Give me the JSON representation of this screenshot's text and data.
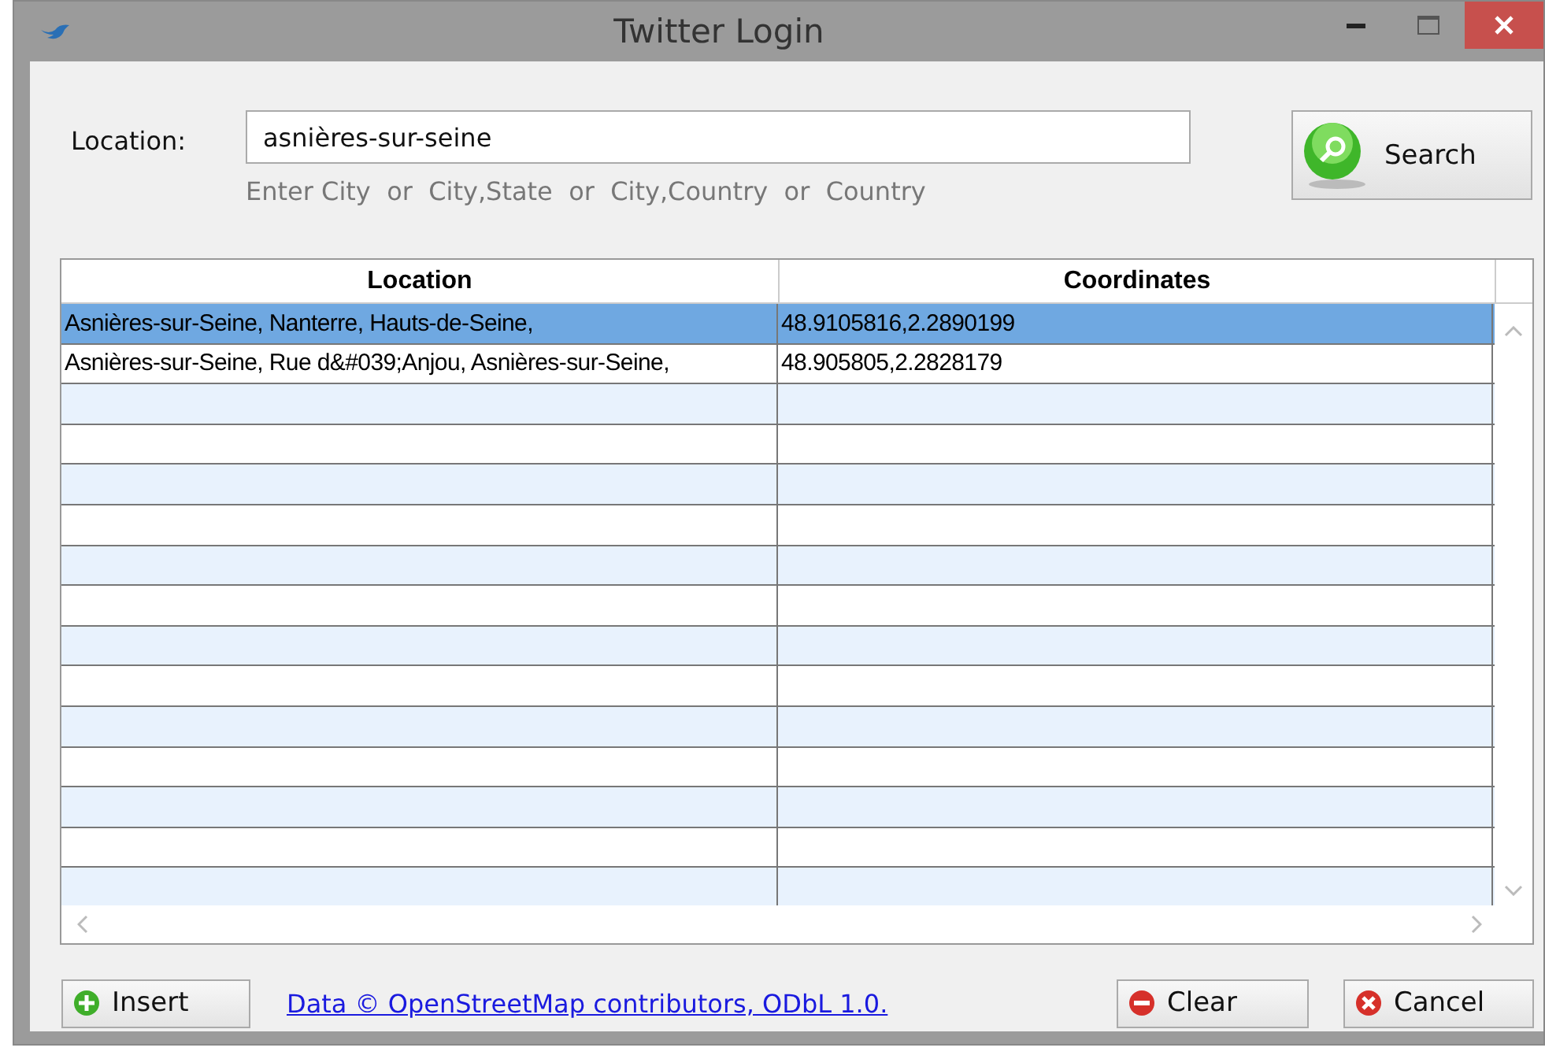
{
  "window": {
    "title": "Twitter Login"
  },
  "location": {
    "label": "Location:",
    "value": "asnières-sur-seine",
    "hint": "Enter City  or  City,State  or  City,Country  or  Country"
  },
  "search_button": "Search",
  "table": {
    "columns": [
      "Location",
      "Coordinates"
    ],
    "rows": [
      {
        "cells": [
          "Asnières-sur-Seine, Nanterre, Hauts-de-Seine,",
          "48.9105816,2.2890199"
        ],
        "selected": true
      },
      {
        "cells": [
          "Asnières-sur-Seine, Rue d&#039;Anjou, Asnières-sur-Seine,",
          "48.905805,2.2828179"
        ],
        "selected": false
      }
    ]
  },
  "footer": {
    "insert": "Insert",
    "link": "Data © OpenStreetMap contributors, ODbL 1.0.",
    "clear": "Clear",
    "cancel": "Cancel"
  }
}
